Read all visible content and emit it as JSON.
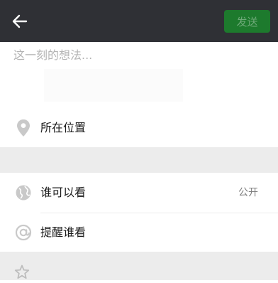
{
  "topbar": {
    "back_icon": "arrow-left-icon",
    "send_label": "发送",
    "background": "#2f3035",
    "send_color": "#1d7a2d"
  },
  "compose": {
    "placeholder": "这一刻的想法...",
    "value": ""
  },
  "location": {
    "icon": "location-pin-icon",
    "label": "所在位置"
  },
  "visibility": {
    "icon": "globe-icon",
    "label": "谁可以看",
    "value": "公开"
  },
  "mention": {
    "icon": "at-sign-icon",
    "label": "提醒谁看"
  },
  "more": {
    "icon": "star-icon"
  }
}
